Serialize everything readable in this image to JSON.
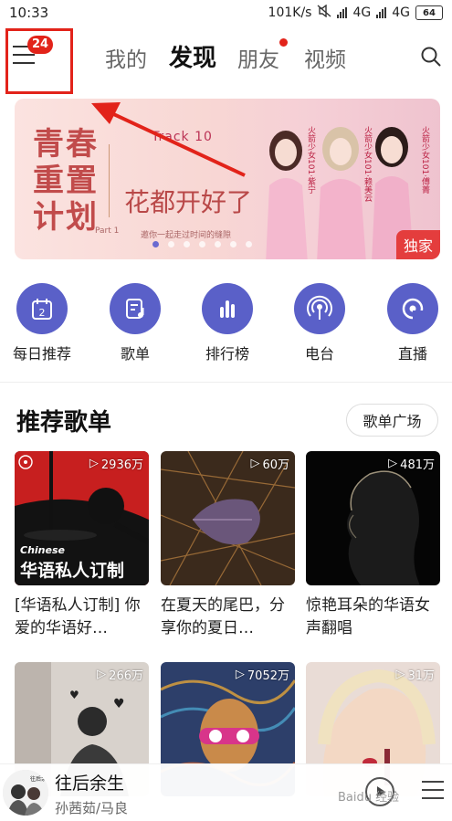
{
  "status_bar": {
    "time": "10:33",
    "speed": "101K/s",
    "net1": "4G",
    "net2": "4G",
    "battery": "64"
  },
  "nav": {
    "badge_count": "24",
    "tabs": [
      "我的",
      "发现",
      "朋友",
      "视频"
    ],
    "active_tab": "发现"
  },
  "banner": {
    "title_lines": [
      "青春",
      "重置",
      "计划"
    ],
    "track": "Track 10",
    "headline": "花都开好了",
    "part": "Part 1",
    "subtitle": "邀你一起走过时间的缝隙",
    "tag": "独家",
    "captions": [
      "火箭少女101·紫宁",
      "火箭少女101·赖美云",
      "火箭少女101·傅菁"
    ],
    "slide_count": 7,
    "active_slide": 1
  },
  "quick_entries": [
    {
      "label": "每日推荐",
      "icon": "calendar-icon",
      "day": "2"
    },
    {
      "label": "歌单",
      "icon": "playlist-icon"
    },
    {
      "label": "排行榜",
      "icon": "chart-icon"
    },
    {
      "label": "电台",
      "icon": "radio-icon"
    },
    {
      "label": "直播",
      "icon": "live-icon"
    }
  ],
  "section": {
    "title": "推荐歌单",
    "more_button": "歌单广场"
  },
  "playlists": [
    {
      "count": "2936万",
      "title": "[华语私人订制] 你爱的华语好…",
      "overlay_small": "Chinese",
      "overlay_big": "华语私人订制"
    },
    {
      "count": "60万",
      "title": "在夏天的尾巴，分享你的夏日…"
    },
    {
      "count": "481万",
      "title": "惊艳耳朵的华语女声翻唱"
    },
    {
      "count": "266万",
      "title": ""
    },
    {
      "count": "7052万",
      "title": ""
    },
    {
      "count": "31万",
      "title": ""
    }
  ],
  "player": {
    "song": "往后余生",
    "artist": "孙茜茹/马良",
    "art_text": "往后余生"
  },
  "watermark": "Baidu 经验",
  "colors": {
    "accent": "#e2231a",
    "icon_bg": "#5a60c8"
  }
}
